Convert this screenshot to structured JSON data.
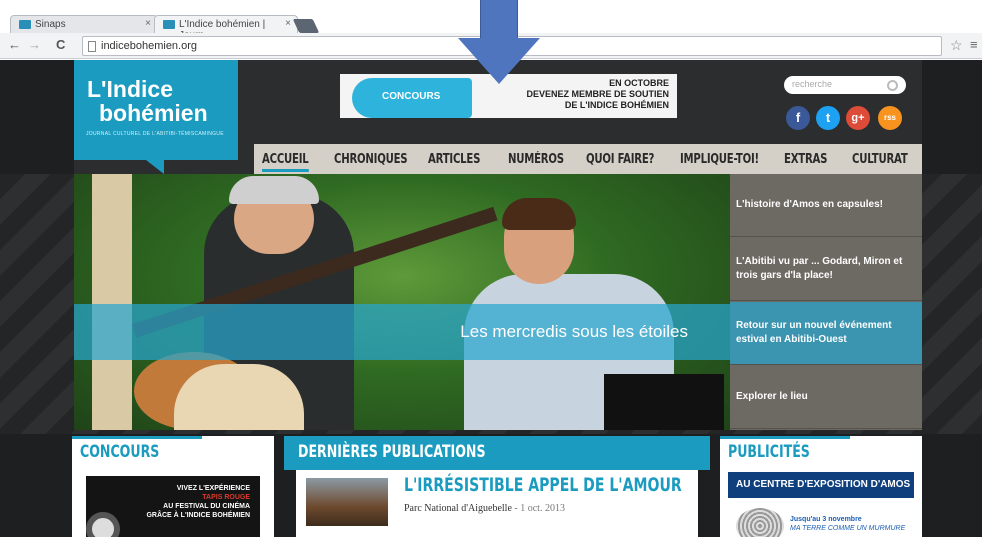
{
  "browser": {
    "tabs": [
      {
        "label": "Sinaps",
        "close": "×"
      },
      {
        "label": "L'Indice bohémien | Journ",
        "close": "×"
      }
    ],
    "back": "←",
    "forward": "→",
    "reload": "C",
    "url": "indicebohemien.org",
    "star": "☆",
    "menu": "≡"
  },
  "header": {
    "logo_line1": "L'Indice",
    "logo_line2": "bohémien",
    "logo_tagline": "JOURNAL CULTUREL DE L'ABITIBI-TÉMISCAMINGUE",
    "banner_badge": "CONCOURS",
    "banner_line1": "EN OCTOBRE",
    "banner_line2": "DEVENEZ MEMBRE DE SOUTIEN",
    "banner_line3": "DE L'INDICE BOHÉMIEN",
    "search_placeholder": "recherche",
    "social": [
      "f",
      "t",
      "g+",
      "rss"
    ]
  },
  "nav": {
    "items": [
      "ACCUEIL",
      "CHRONIQUES",
      "ARTICLES",
      "NUMÉROS",
      "QUOI FAIRE?",
      "IMPLIQUE-TOI!",
      "EXTRAS",
      "CULTURAT"
    ],
    "active": "ACCUEIL"
  },
  "hero": {
    "caption": "Les mercredis sous les étoiles"
  },
  "sidebar_features": [
    "L'histoire d'Amos en capsules!",
    "L'Abitibi vu par ... Godard, Miron et trois gars d'la place!",
    "Retour sur un nouvel événement estival en Abitibi-Ouest",
    "Explorer le lieu"
  ],
  "concours": {
    "title": "CONCOURS",
    "ad_line1": "VIVEZ L'EXPÉRIENCE",
    "ad_line2": "TAPIS ROUGE",
    "ad_line3": "AU FESTIVAL DU CINÉMA",
    "ad_line4": "GRÂCE À L'INDICE BOHÉMIEN"
  },
  "publications": {
    "title": "DERNIÈRES PUBLICATIONS",
    "article_title": "L'IRRÉSISTIBLE APPEL DE L'AMOUR",
    "article_meta": "Parc National d'Aiguebelle",
    "article_date": " - 1 oct. 2013"
  },
  "publicites": {
    "title": "PUBLICITÉS",
    "box": "AU CENTRE D'EXPOSITION D'AMOS",
    "ad_line1": "Jusqu'au 3 novembre",
    "ad_line2": "MA TERRE COMME UN MURMURE"
  },
  "colors": {
    "brand": "#1a9bbf",
    "dark": "#1d1f21",
    "nav_bg": "#d4d0c8",
    "arrow": "#4f75bf",
    "pub_box": "#0f3f7c"
  }
}
